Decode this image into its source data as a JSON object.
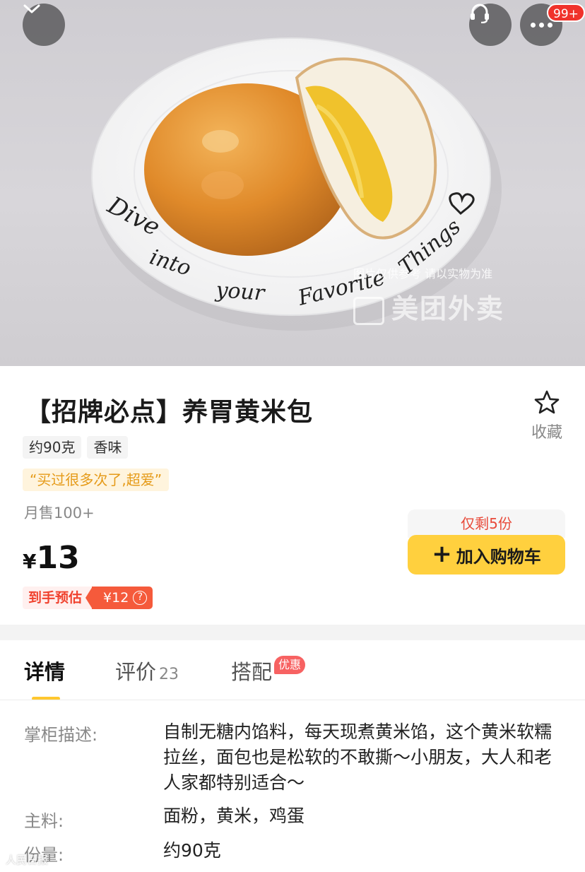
{
  "hero": {
    "plate_text": "Dive into your Favorite Things",
    "watermark_notice": "图片仅供参考 请以实物为准",
    "watermark_brand": "美团外卖",
    "more_badge": "99+",
    "icons": [
      "chevron-down-icon",
      "customer-service-icon",
      "more-dots-icon"
    ]
  },
  "product": {
    "title": "【招牌必点】养胃黄米包",
    "favorite_label": "收藏",
    "tags": [
      "约90克",
      "香味"
    ],
    "review_quote": "“买过很多次了,超爱”",
    "monthly_sales": "月售100+",
    "price_symbol": "¥",
    "price": "13",
    "estimate_label": "到手预估",
    "estimate_price": "¥12",
    "estimate_help": "?",
    "stock_notice": "仅剩5份",
    "cart_plus": "+",
    "cart_button": "加入购物车"
  },
  "tabs": {
    "detail": "详情",
    "review": "评价",
    "review_count": "23",
    "combo": "搭配",
    "combo_badge": "优惠"
  },
  "details": [
    {
      "label": "掌柜描述:",
      "value": "自制无糖内馅料，每天现煮黄米馅，这个黄米软糯拉丝，面包也是松软的不敢撕～小朋友，大人和老人家都特别适合～"
    },
    {
      "label": "主料:",
      "value": "面粉，黄米，鸡蛋"
    },
    {
      "label": "份量:",
      "value": "约90克"
    }
  ],
  "bottom_watermark": "人民日报",
  "colors": {
    "accent_yellow": "#ffd03e",
    "tab_underline": "#ffc72e",
    "price_red": "#f55a3b",
    "stock_red": "#e84a3a",
    "review_orange": "#e59a18"
  }
}
